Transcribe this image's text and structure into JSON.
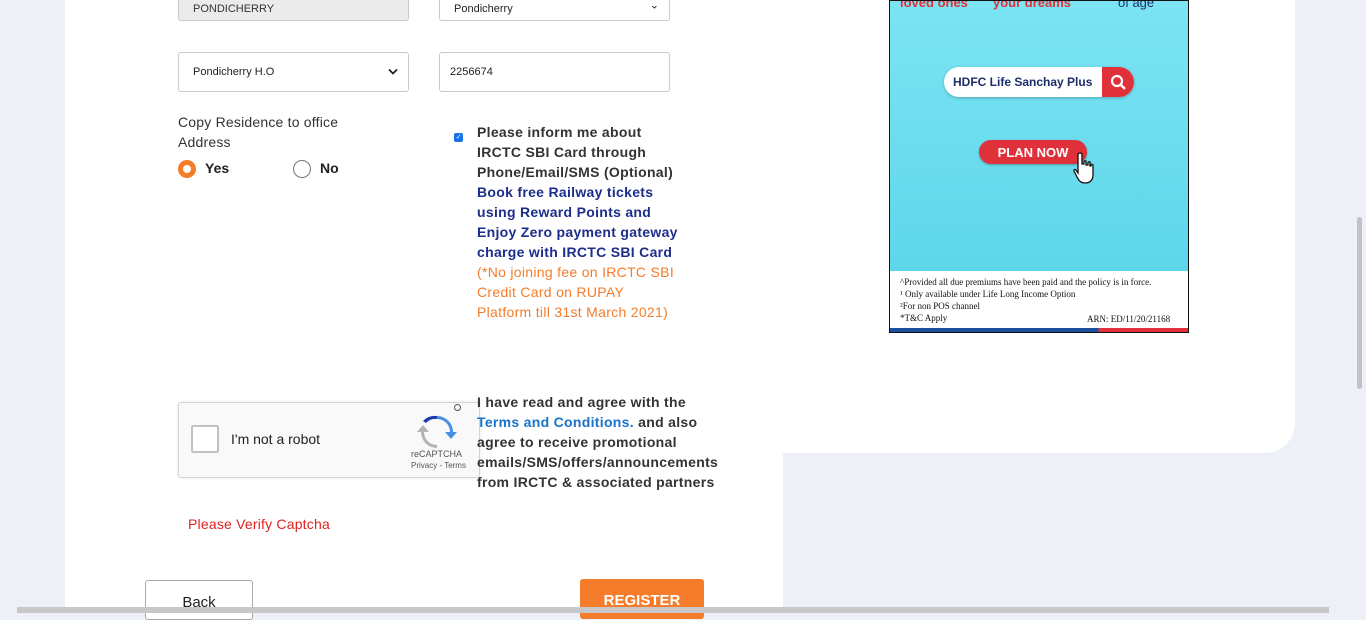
{
  "form": {
    "state_value": "PONDICHERRY",
    "city_value": "Pondicherry",
    "post_office_value": "Pondicherry H.O",
    "phone_value": "2256674",
    "copy_address_label": "Copy Residence to office Address",
    "radio_yes": "Yes",
    "radio_no": "No",
    "inform_text": "Please inform me about IRCTC SBI Card through Phone/Email/SMS (Optional)",
    "promo_text": "Book free Railway tickets using Reward Points and Enjoy Zero payment gateway charge with IRCTC SBI Card",
    "fee_text": "(*No joining fee on IRCTC SBI Credit Card on RUPAY Platform till 31st March 2021)",
    "terms_prefix": "I have read and agree with the",
    "terms_link": "Terms and Conditions.",
    "terms_suffix": "and also agree to receive promotional emails/SMS/offers/announcements from IRCTC & associated partners",
    "captcha_error": "Please Verify Captcha",
    "back_button": "Back",
    "register_button": "REGISTER"
  },
  "recaptcha": {
    "label": "I'm not a robot",
    "brand": "reCAPTCHA",
    "links": "Privacy - Terms"
  },
  "ad": {
    "top_left": "loved ones",
    "top_mid": "your dreams",
    "top_right": "of age",
    "search_text": "HDFC Life Sanchay Plus",
    "cta": "PLAN NOW",
    "fine1": "^Provided all due premiums have been paid and the policy is in force.",
    "fine2": "¹ Only available under Life Long Income Option",
    "fine3": "²For non POS channel",
    "fine4": "*T&C Apply",
    "arn": "ARN: ED/11/20/21168"
  },
  "colors": {
    "accent": "#f47c2a",
    "link": "#1a73c9",
    "promo": "#1d2e8a",
    "error": "#e02020"
  }
}
